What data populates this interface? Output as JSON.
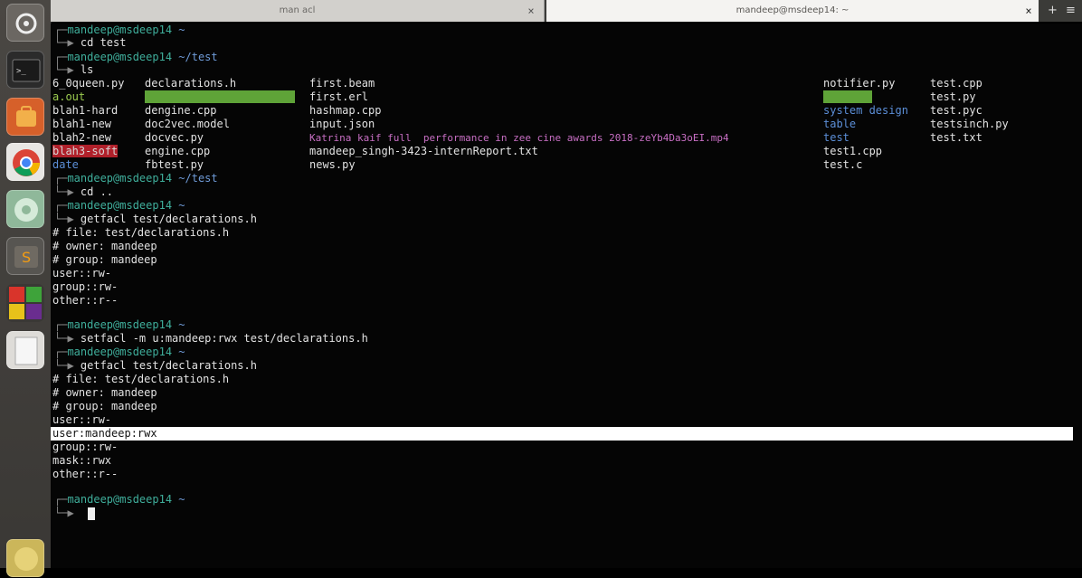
{
  "tabs": [
    {
      "title": "man acl",
      "active": false
    },
    {
      "title": "mandeep@msdeep14: ~",
      "active": true
    }
  ],
  "tab_close_glyph": "×",
  "new_tab_glyph": "+",
  "menu_glyph": "≡",
  "launcher": [
    "dash-home-icon",
    "terminal-icon",
    "ubuntu-software-icon",
    "chrome-icon",
    "settings-icon",
    "sublime-text-icon",
    "libreoffice-icon",
    "files-icon",
    "trash-icon"
  ],
  "prompt": {
    "user": "mandeep@msdeep14",
    "home": "~",
    "test": "~/test"
  },
  "commands": {
    "cd_test": "cd test",
    "ls": "ls",
    "cd_up": "cd ..",
    "getfacl1": "getfacl test/declarations.h",
    "setfacl": "setfacl -m u:mandeep:rwx test/declarations.h",
    "getfacl2": "getfacl test/declarations.h"
  },
  "ls_output": {
    "col1": [
      "6_0queen.py",
      "a.out",
      "blah1-hard",
      "blah1-new",
      "blah2-new",
      "blah3-soft",
      "date"
    ],
    "col2": [
      "declarations.h",
      "",
      "dengine.cpp",
      "doc2vec.model",
      "docvec.py",
      "engine.cpp",
      "fbtest.py"
    ],
    "col3": [
      "first.beam",
      "first.erl",
      "hashmap.cpp",
      "input.json",
      "Katrina kaif full  performance in zee cine awards 2018-zeYb4Da3oEI.mp4",
      "mandeep_singh-3423-internReport.txt",
      "news.py"
    ],
    "col4": [
      "notifier.py",
      "",
      "system design",
      "table",
      "test",
      "test1.cpp",
      "test.c"
    ],
    "col5": [
      "test.cpp",
      "test.py",
      "test.pyc",
      "testsinch.py",
      "test.txt"
    ]
  },
  "getfacl1_output": [
    "# file: test/declarations.h",
    "# owner: mandeep",
    "# group: mandeep",
    "user::rw-",
    "group::rw-",
    "other::r--"
  ],
  "getfacl2_output": [
    "# file: test/declarations.h",
    "# owner: mandeep",
    "# group: mandeep",
    "user::rw-",
    "user:mandeep:rwx",
    "group::rw-",
    "mask::rwx",
    "other::r--"
  ],
  "colors": {
    "prompt_user": "#3fae9b",
    "prompt_path": "#6f9bd8",
    "highlight": "#5fa338",
    "broken_link": "#b0202a"
  }
}
